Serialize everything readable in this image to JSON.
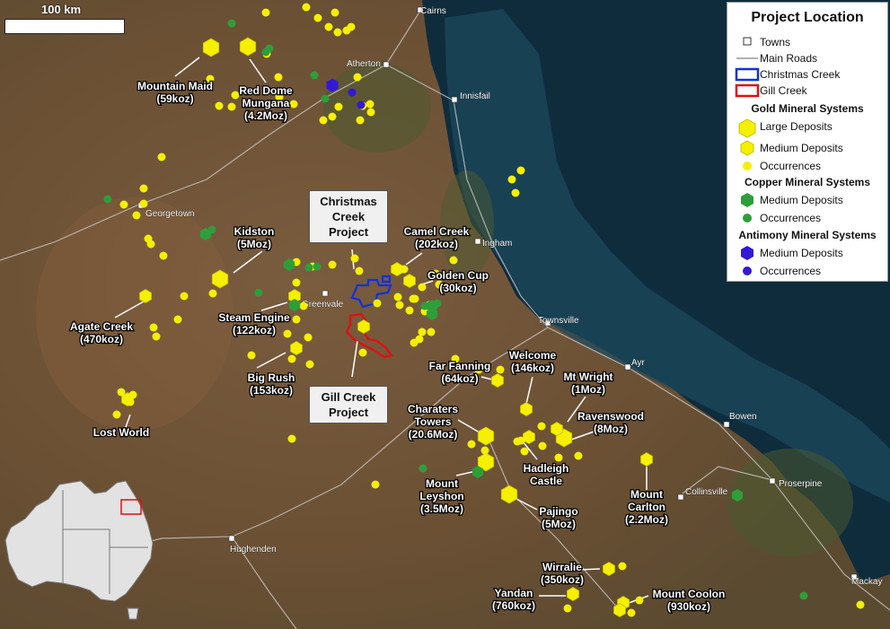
{
  "scale": {
    "label": "100 km"
  },
  "legend": {
    "title": "Project Location",
    "towns": "Towns",
    "roads": "Main Roads",
    "christmas_creek": "Christmas Creek",
    "gill_creek": "Gill Creek",
    "gold_head": "Gold Mineral Systems",
    "gold_large": "Large Deposits",
    "gold_medium": "Medium Deposits",
    "gold_occ": "Occurrences",
    "copper_head": "Copper Mineral Systems",
    "copper_medium": "Medium Deposits",
    "copper_occ": "Occurrences",
    "antimony_head": "Antimony Mineral Systems",
    "antimony_medium": "Medium Deposits",
    "antimony_occ": "Occurrences"
  },
  "callouts": {
    "christmas": [
      "Christmas",
      "Creek",
      "Project"
    ],
    "gill": [
      "Gill Creek",
      "Project"
    ]
  },
  "towns": [
    "Cairns",
    "Atherton",
    "Innisfail",
    "Georgetown",
    "Ingham",
    "Greenvale",
    "Townsville",
    "Ayr",
    "Bowen",
    "Collinsville",
    "Proserpine",
    "Hughenden",
    "Mackay"
  ],
  "deposits": [
    [
      "Mountain Maid",
      "(59koz)"
    ],
    [
      "Red Dome",
      "Mungana",
      "(4.2Moz)"
    ],
    [
      "Kidston",
      "(5Moz)"
    ],
    [
      "Camel Creek",
      "(202koz)"
    ],
    [
      "Golden Cup",
      "(30koz)"
    ],
    [
      "Agate Creek",
      "(470koz)"
    ],
    [
      "Steam Engine",
      "(122koz)"
    ],
    [
      "Big Rush",
      "(153koz)"
    ],
    [
      "Lost World"
    ],
    [
      "Far Fanning",
      "(64koz)"
    ],
    [
      "Welcome",
      "(146koz)"
    ],
    [
      "Mt Wright",
      "(1Moz)"
    ],
    [
      "Charaters",
      "Towers",
      "(20.6Moz)"
    ],
    [
      "Ravenswood",
      "(8Moz)"
    ],
    [
      "Hadleigh",
      "Castle"
    ],
    [
      "Mount",
      "Leyshon",
      "(3.5Moz)"
    ],
    [
      "Pajingo",
      "(5Moz)"
    ],
    [
      "Mount",
      "Carlton",
      "(2.2Moz)"
    ],
    [
      "Wirralie",
      "(350koz)"
    ],
    [
      "Yandan",
      "(760koz)"
    ],
    [
      "Mount Coolon",
      "(930koz)"
    ]
  ],
  "colors": {
    "gold": "#f5f000",
    "copper": "#2e9e3a",
    "antimony": "#3318d8",
    "christmas_outline": "#1030e0",
    "gill_outline": "#e01010",
    "ocean": "#0d2a3c",
    "land": "#6b5238"
  }
}
